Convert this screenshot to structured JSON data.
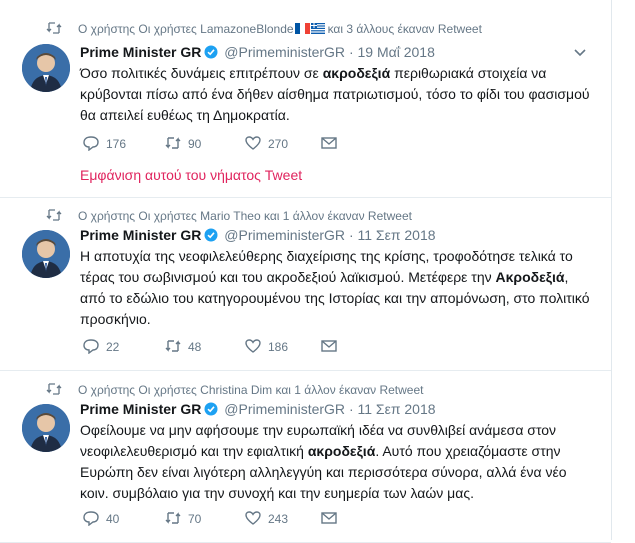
{
  "tweets": [
    {
      "retweet_line": "Ο χρήστης Οι χρήστες LamazoneBlonde",
      "retweet_suffix": "και 3 άλλους έκαναν Retweet",
      "name": "Prime Minister GR",
      "handle": "@PrimeministerGR",
      "dot": "·",
      "date": "19 Μαΐ 2018",
      "text_parts": [
        "Όσο πολιτικές δυνάμεις επιτρέπουν σε ",
        "ακροδεξιά",
        " περιθωριακά στοιχεία να κρύβονται πίσω από ένα δήθεν αίσθημα πατριωτισμού, τόσο το φίδι του φασισμού θα απειλεί ευθέως τη Δημοκρατία."
      ],
      "replies": "176",
      "retweets": "90",
      "likes": "270",
      "thread_link": "Εμφάνιση αυτού του νήματος Tweet"
    },
    {
      "retweet_line": "Ο χρήστης Οι χρήστες Mario Theo και 1 άλλον έκαναν Retweet",
      "name": "Prime Minister GR",
      "handle": "@PrimeministerGR",
      "dot": "·",
      "date": "11 Σεπ 2018",
      "text_parts": [
        "Η αποτυχία της νεοφιλελεύθερης διαχείρισης της κρίσης, τροφοδότησε τελικά το τέρας του σωβινισμού και του ακροδεξιού λαϊκισμού. Μετέφερε την ",
        "Ακροδεξιά",
        ", από το εδώλιο του κατηγορουμένου της Ιστορίας και την απομόνωση, στο πολιτικό προσκήνιο."
      ],
      "replies": "22",
      "retweets": "48",
      "likes": "186"
    },
    {
      "retweet_line": "Ο χρήστης Οι χρήστες Christina Dim και 1 άλλον έκαναν Retweet",
      "name": "Prime Minister GR",
      "handle": "@PrimeministerGR",
      "dot": "·",
      "date": "11 Σεπ 2018",
      "text_parts": [
        "Οφείλουμε να μην αφήσουμε την ευρωπαϊκή ιδέα να συνθλιβεί ανάμεσα στον νεοφιλελευθερισμό και την εφιαλτική ",
        "ακροδεξιά",
        ". Αυτό που χρειαζόμαστε στην Ευρώπη δεν είναι λιγότερη αλληλεγγύη και περισσότερα σύνορα, αλλά ένα νέο κοιν. συμβόλαιο για την συνοχή και την ευημερία των λαών μας."
      ],
      "replies": "40",
      "retweets": "70",
      "likes": "243"
    }
  ],
  "colors": {
    "link": "#e0245e",
    "muted": "#657786",
    "verified": "#1da1f2"
  }
}
